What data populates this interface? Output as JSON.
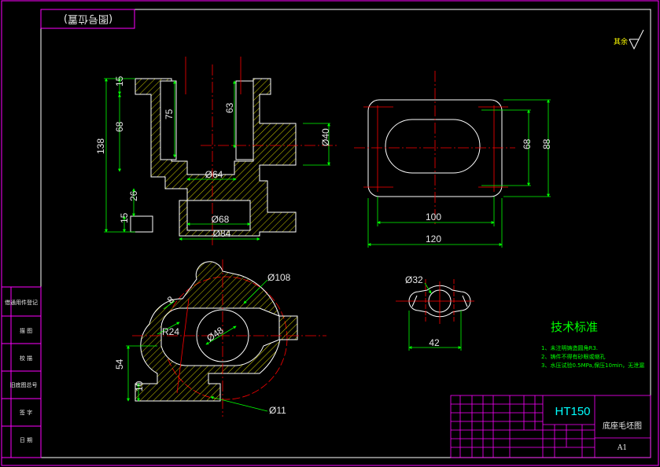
{
  "drawing": {
    "title_box": "(图号位置)",
    "surface_finish": "其余",
    "material": "HT150",
    "part_name": "底座毛坯图",
    "sheet_size": "A1",
    "tech_title": "技术标准",
    "tech_notes": [
      "1、未注明铸造圆角R3.",
      "2、铸件不得有砂眼或缩孔",
      "3、水压试验0.5MPa,保压10min，无泄漏"
    ],
    "side_labels": [
      "借通用件登记",
      "描 图",
      "校 描",
      "旧底图总号",
      "签 字",
      "日 期"
    ],
    "dimensions": {
      "d15a": "15",
      "d68": "68",
      "d138": "138",
      "d75": "75",
      "d63": "63",
      "d40": "Ø40",
      "d64": "Ø64",
      "d26": "26",
      "d15b": "15",
      "d68b": "Ø68",
      "d84": "Ø84",
      "d68r": "68",
      "d88": "88",
      "d100": "100",
      "d120": "120",
      "d108": "Ø108",
      "d8": "8",
      "r24": "R24",
      "d48": "Ø48",
      "d54": "54",
      "d10": "10",
      "d11": "Ø11",
      "d32": "Ø32",
      "d42": "42"
    },
    "colors": {
      "border": "#ff00ff",
      "outline": "#ffffff",
      "center": "#ff0000",
      "dimension": "#00ff00",
      "hatch": "#ffff00",
      "material_text": "#00ffff"
    }
  }
}
